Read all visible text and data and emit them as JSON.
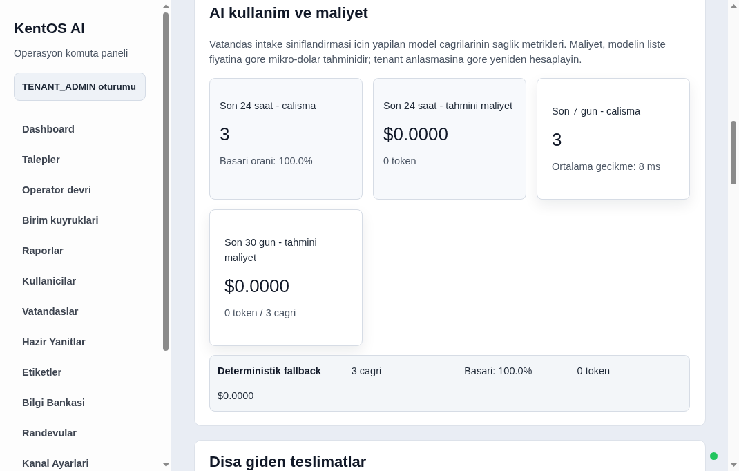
{
  "sidebar": {
    "brand": "KentOS AI",
    "subtitle": "Operasyon komuta paneli",
    "session_badge": "TENANT_ADMIN oturumu",
    "items": [
      {
        "label": "Dashboard",
        "selected": false
      },
      {
        "label": "Talepler",
        "selected": false
      },
      {
        "label": "Operator devri",
        "selected": false
      },
      {
        "label": "Birim kuyruklari",
        "selected": false
      },
      {
        "label": "Raporlar",
        "selected": false
      },
      {
        "label": "Kullanicilar",
        "selected": false
      },
      {
        "label": "Vatandaslar",
        "selected": false
      },
      {
        "label": "Hazir Yanitlar",
        "selected": false
      },
      {
        "label": "Etiketler",
        "selected": false
      },
      {
        "label": "Bilgi Bankasi",
        "selected": false
      },
      {
        "label": "Randevular",
        "selected": false
      },
      {
        "label": "Kanal Ayarlari",
        "selected": false
      }
    ]
  },
  "sections": [
    {
      "title": "AI kullanim ve maliyet",
      "description": "Vatandas intake siniflandirmasi icin yapilan model cagrilarinin saglik metrikleri. Maliyet, modelin liste fiyatina gore mikro-dolar tahminidir; tenant anlasmasina gore yeniden hesaplayin.",
      "metrics": [
        {
          "kind": "flat",
          "label": "Son 24 saat - calisma",
          "value": "3",
          "detail": "Basari orani: 100.0%"
        },
        {
          "kind": "flat",
          "label": "Son 24 saat - tahmini maliyet",
          "value": "$0.0000",
          "detail": "0 token"
        },
        {
          "kind": "raised",
          "label": "Son 7 gun - calisma",
          "value": "3",
          "detail": "Ortalama gecikme: 8 ms"
        },
        {
          "kind": "raised",
          "label": "Son 30 gun - tahmini maliyet",
          "value": "$0.0000",
          "detail": "0 token / 3 cagri"
        }
      ],
      "fallback": {
        "label": "Deterministik fallback",
        "calls": "3 cagri",
        "success": "Basari: 100.0%",
        "tokens": "0 token",
        "cost": "$0.0000"
      }
    },
    {
      "title": "Disa giden teslimatlar"
    }
  ]
}
